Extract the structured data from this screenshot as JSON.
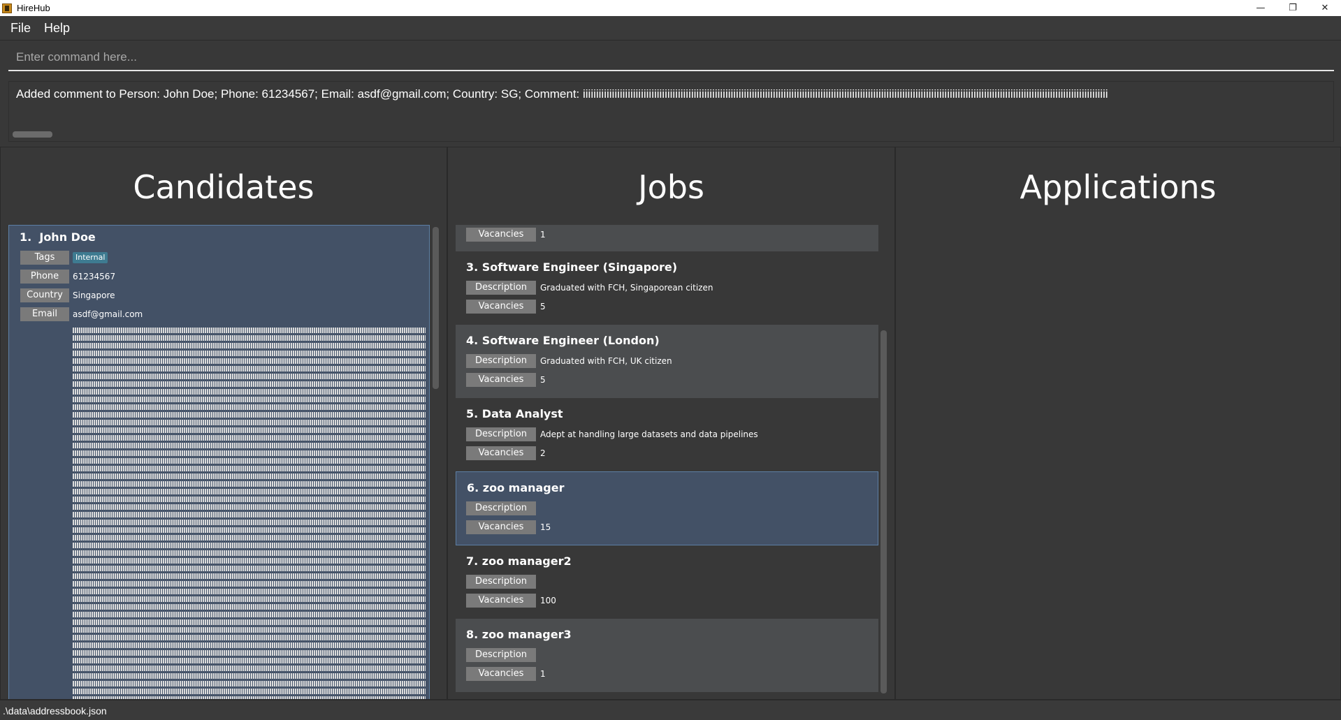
{
  "window": {
    "title": "HireHub",
    "minimize": "—",
    "restore": "❐",
    "close": "✕"
  },
  "menu": {
    "file": "File",
    "help": "Help"
  },
  "command": {
    "placeholder": "Enter command here...",
    "value": ""
  },
  "result": {
    "text": "Added comment to Person: John Doe; Phone: 61234567; Email: asdf@gmail.com; Country: SG; Comment: iiiiiiiiiiiiiiiiiiiiiiiiiiiiiiiiiiiiiiiiiiiiiiiiiiiiiiiiiiiiiiiiiiiiiiiiiiiiiiiiiiiiiiiiiiiiiiiiiiiiiiiiiiiiiiiiiiiiiiiiiiiiiiiiiiiiiiiiiiiiiiiiiiiiiiiiiiiiiiiiiiiiiiiiiiiiiiiiiiiiiiiiiiiiiiiiiiiiiii"
  },
  "panels": {
    "candidates": "Candidates",
    "jobs": "Jobs",
    "applications": "Applications"
  },
  "candidates": [
    {
      "index": "1.",
      "name": "John Doe",
      "labels": {
        "tags": "Tags",
        "phone": "Phone",
        "country": "Country",
        "email": "Email"
      },
      "tag": "Internal",
      "phone": "61234567",
      "country": "Singapore",
      "email": "asdf@gmail.com"
    }
  ],
  "jobs": {
    "labels": {
      "description": "Description",
      "vacancies": "Vacancies"
    },
    "partial": {
      "vacancies": "1"
    },
    "items": [
      {
        "title": "3.  Software Engineer (Singapore)",
        "description": "Graduated with FCH, Singaporean citizen",
        "vacancies": "5"
      },
      {
        "title": "4.  Software Engineer (London)",
        "description": "Graduated with FCH, UK citizen",
        "vacancies": "5"
      },
      {
        "title": "5.  Data Analyst",
        "description": "Adept at handling large datasets and data pipelines",
        "vacancies": "2"
      },
      {
        "title": "6.  zoo manager",
        "description": "",
        "vacancies": "15"
      },
      {
        "title": "7.  zoo manager2",
        "description": "",
        "vacancies": "100"
      },
      {
        "title": "8.  zoo manager3",
        "description": "",
        "vacancies": "1"
      }
    ]
  },
  "status": {
    "path": ".\\data\\addressbook.json"
  },
  "colors": {
    "selected": "#435166",
    "alt_row": "#4b4d4f",
    "row": "#383838",
    "label": "#7a7a7a",
    "tag": "#3e7b91"
  }
}
